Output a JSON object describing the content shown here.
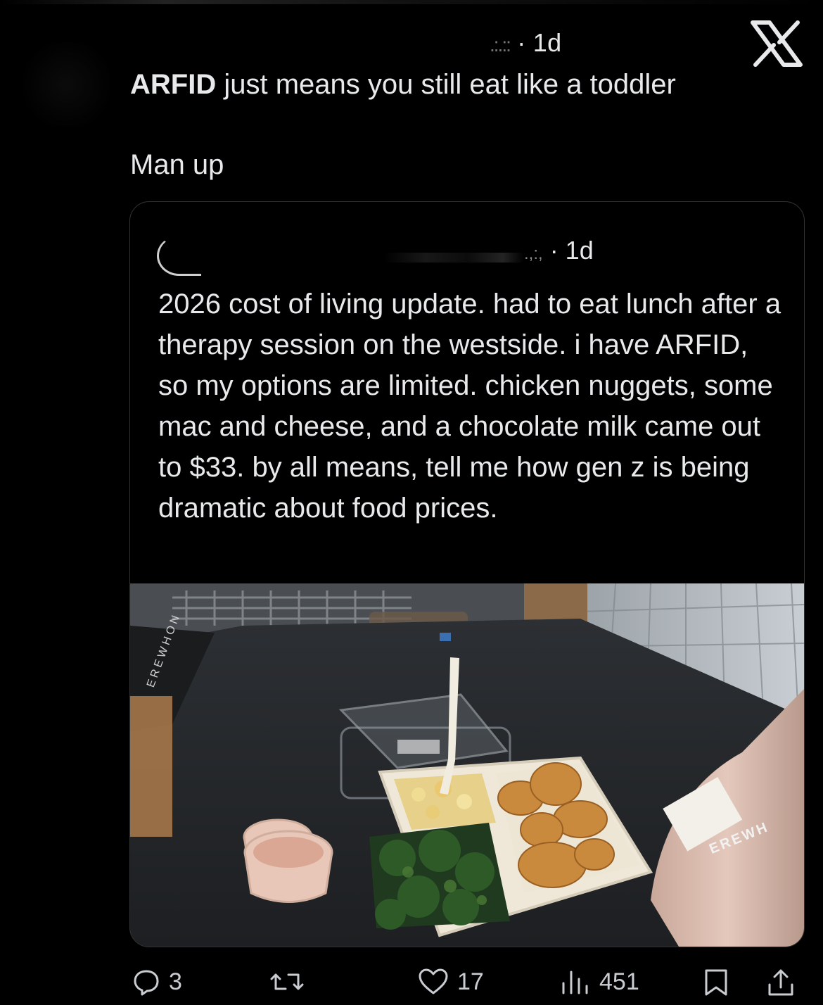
{
  "post": {
    "meta": "· 1d",
    "text_bold": "ARFID",
    "text_rest": " just means you still eat like a toddler",
    "text_line2": "Man up"
  },
  "quote": {
    "meta": "· 1d",
    "text": "2026 cost of living update. had to eat lunch after a therapy session on the westside. i have ARFID, so my options are limited. chicken nuggets, some mac and cheese, and a chocolate milk came out to $33. by all means, tell me how gen z is being dramatic about food prices."
  },
  "photo_labels": {
    "bottle_label": "EREWH",
    "mat_label": "EREWHON"
  },
  "actions": {
    "replies": "3",
    "reposts": "",
    "likes": "17",
    "views": "451"
  },
  "icons": [
    "x-logo-icon",
    "reply-icon",
    "repost-icon",
    "like-icon",
    "views-icon",
    "bookmark-icon",
    "share-icon"
  ],
  "colors": {
    "background": "#000000",
    "text": "#e7e9ea",
    "border": "#333333",
    "muted": "#c9cdd1"
  }
}
